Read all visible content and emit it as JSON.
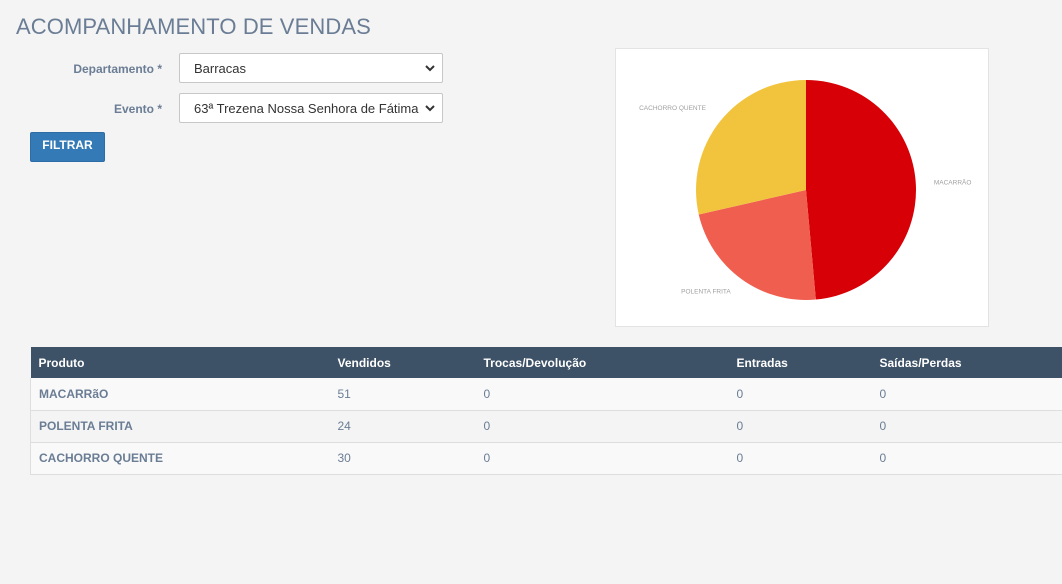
{
  "page": {
    "title": "ACOMPANHAMENTO DE VENDAS"
  },
  "form": {
    "departamento": {
      "label": "Departamento *",
      "value": "Barracas"
    },
    "evento": {
      "label": "Evento *",
      "value": "63ª Trezena Nossa Senhora de Fátima"
    },
    "filter_button": "FILTRAR"
  },
  "chart_data": {
    "type": "pie",
    "categories": [
      "MACARRãO",
      "POLENTA FRITA",
      "CACHORRO QUENTE"
    ],
    "values": [
      51,
      24,
      30
    ],
    "colors": [
      "#d70006",
      "#f05e50",
      "#f2c43d"
    ]
  },
  "table": {
    "headers": [
      "Produto",
      "Vendidos",
      "Trocas/Devolução",
      "Entradas",
      "Saídas/Perdas"
    ],
    "rows": [
      [
        "MACARRãO",
        "51",
        "0",
        "0",
        "0"
      ],
      [
        "POLENTA FRITA",
        "24",
        "0",
        "0",
        "0"
      ],
      [
        "CACHORRO QUENTE",
        "30",
        "0",
        "0",
        "0"
      ]
    ]
  },
  "icons": {
    "select_arrow": "chevron-down-icon"
  },
  "colors": {
    "accent": "#337ab7",
    "table_header": "#3d5266",
    "title": "#6a7d95"
  }
}
